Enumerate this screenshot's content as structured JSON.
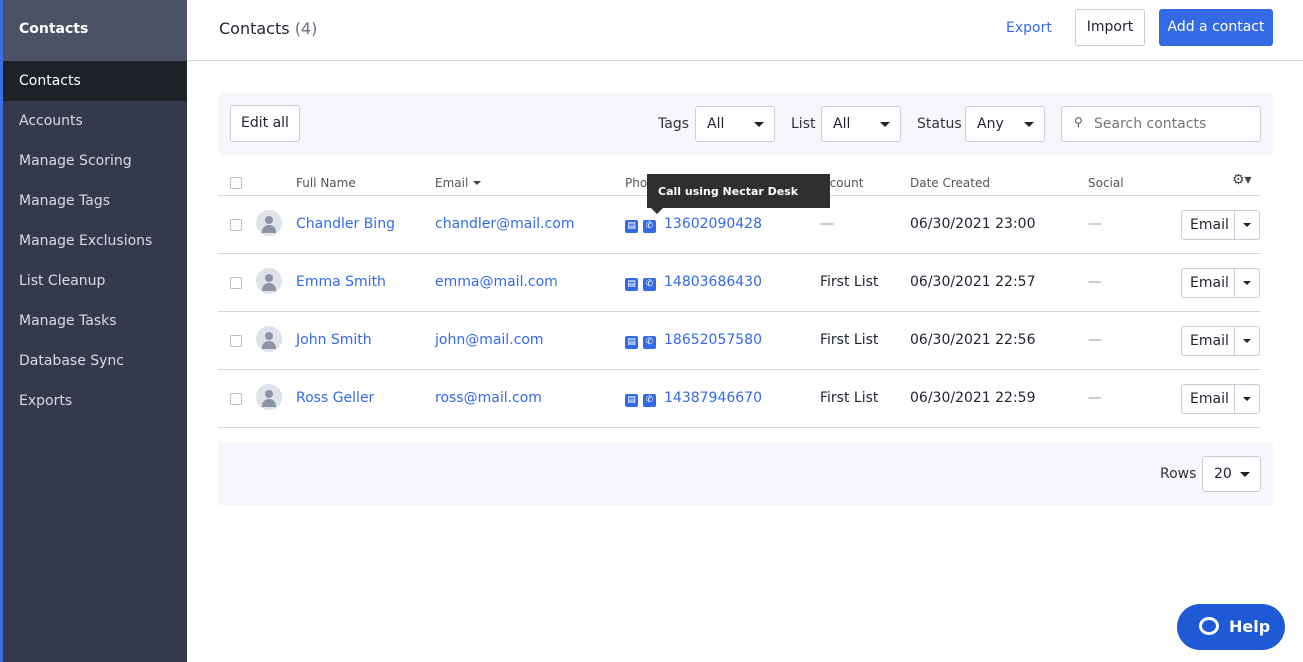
{
  "sidebar": {
    "header": "Contacts",
    "items": [
      "Contacts",
      "Accounts",
      "Manage Scoring",
      "Manage Tags",
      "Manage Exclusions",
      "List Cleanup",
      "Manage Tasks",
      "Database Sync",
      "Exports"
    ]
  },
  "header": {
    "title": "Contacts",
    "count": "(4)",
    "export": "Export",
    "import": "Import",
    "add": "Add a contact"
  },
  "filters": {
    "edit_all": "Edit all",
    "tags_label": "Tags",
    "tags_value": "All",
    "list_label": "List",
    "list_value": "All",
    "status_label": "Status",
    "status_value": "Any",
    "search_placeholder": "Search contacts"
  },
  "columns": [
    "Full Name",
    "Email",
    "Phone",
    "Account",
    "Date Created",
    "Social"
  ],
  "tooltip": "Call using Nectar Desk",
  "rows": [
    {
      "name": "Chandler Bing",
      "email": "chandler@mail.com",
      "phone": "13602090428",
      "account": "—",
      "date": "06/30/2021 23:00",
      "social": "—",
      "action": "Email"
    },
    {
      "name": "Emma Smith",
      "email": "emma@mail.com",
      "phone": "14803686430",
      "account": "First List",
      "date": "06/30/2021 22:57",
      "social": "—",
      "action": "Email"
    },
    {
      "name": "John Smith",
      "email": "john@mail.com",
      "phone": "18652057580",
      "account": "First List",
      "date": "06/30/2021 22:56",
      "social": "—",
      "action": "Email"
    },
    {
      "name": "Ross Geller",
      "email": "ross@mail.com",
      "phone": "14387946670",
      "account": "First List",
      "date": "06/30/2021 22:59",
      "social": "—",
      "action": "Email"
    }
  ],
  "pagination": {
    "rows_label": "Rows",
    "rows_value": "20"
  },
  "help": "Help",
  "colors": {
    "accent": "#356ae6",
    "sidebar": "#343a4b"
  }
}
